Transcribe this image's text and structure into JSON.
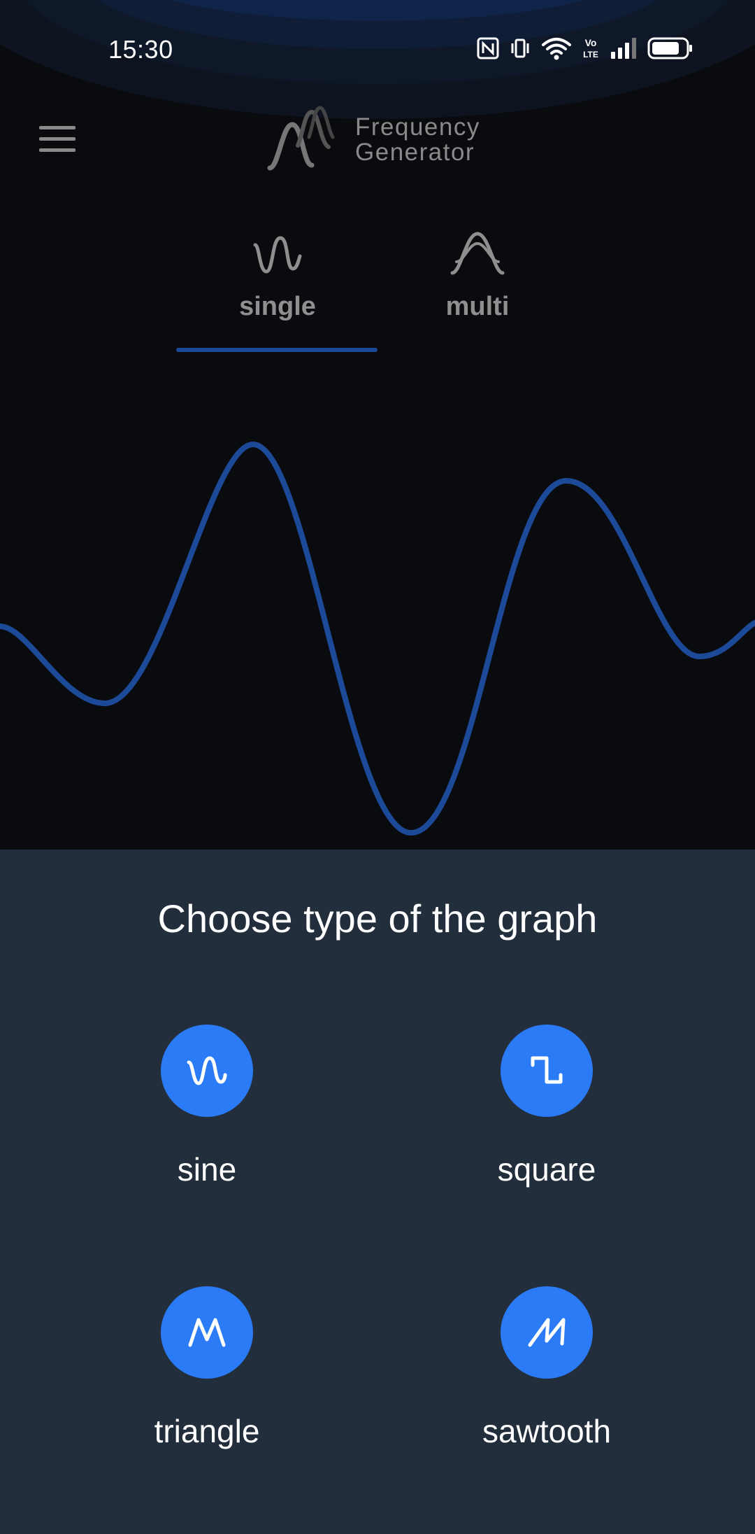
{
  "status_bar": {
    "time": "15:30",
    "icons": [
      "nfc-icon",
      "vibrate-icon",
      "wifi-icon",
      "volte-icon",
      "signal-icon",
      "battery-icon"
    ],
    "volte_text": "Vo LTE"
  },
  "header": {
    "menu_icon": "hamburger-menu-icon",
    "logo_line1": "Frequency",
    "logo_line2": "Generator"
  },
  "tabs": [
    {
      "label": "single",
      "icon": "single-wave-icon",
      "selected": true
    },
    {
      "label": "multi",
      "icon": "multi-wave-icon",
      "selected": false
    }
  ],
  "colors": {
    "background": "#0a0b0f",
    "wave": "#1c4a98",
    "sheet": "#232e3d",
    "accent": "#2a7bf5",
    "muted_text": "#8f8f8f"
  },
  "sheet": {
    "title": "Choose type of the graph",
    "options": [
      {
        "label": "sine",
        "icon": "sine-wave-icon"
      },
      {
        "label": "square",
        "icon": "square-wave-icon"
      },
      {
        "label": "triangle",
        "icon": "triangle-wave-icon"
      },
      {
        "label": "sawtooth",
        "icon": "sawtooth-wave-icon"
      }
    ]
  }
}
